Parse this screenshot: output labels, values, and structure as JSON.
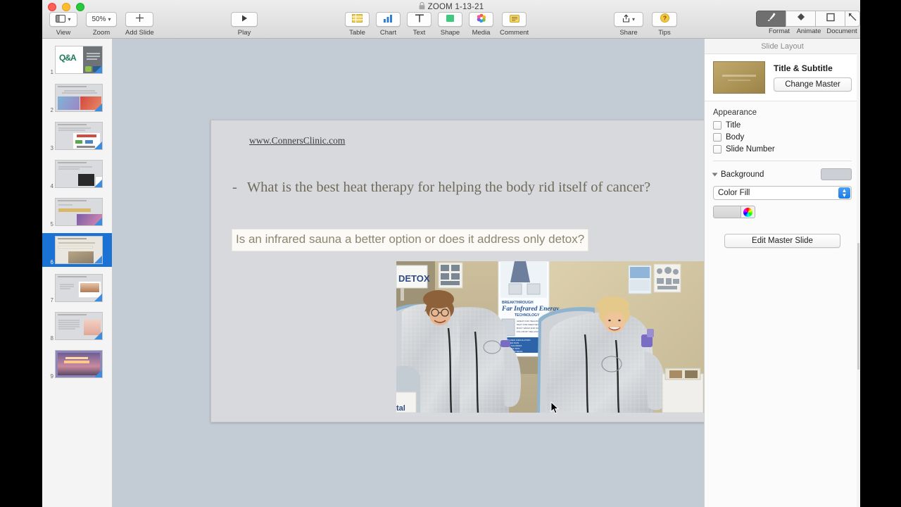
{
  "window": {
    "document_title": "ZOOM 1-13-21",
    "title_icon": "lock-icon"
  },
  "toolbar": {
    "left_items": [
      {
        "name": "view",
        "label": "View",
        "icon": "view-panels-icon",
        "has_chevron": true
      },
      {
        "name": "zoom",
        "label": "Zoom",
        "icon": "zoom-percent",
        "value": "50%",
        "has_chevron": true
      },
      {
        "name": "add-slide",
        "label": "Add Slide",
        "icon": "plus-icon"
      }
    ],
    "play": {
      "label": "Play",
      "icon": "play-triangle-icon"
    },
    "insert_items": [
      {
        "name": "table",
        "label": "Table",
        "icon": "table-icon"
      },
      {
        "name": "chart",
        "label": "Chart",
        "icon": "bar-chart-icon"
      },
      {
        "name": "text",
        "label": "Text",
        "icon": "text-t-icon"
      },
      {
        "name": "shape",
        "label": "Shape",
        "icon": "shape-square-icon"
      },
      {
        "name": "media",
        "label": "Media",
        "icon": "media-photos-icon"
      },
      {
        "name": "comment",
        "label": "Comment",
        "icon": "comment-lines-icon"
      }
    ],
    "right_items": [
      {
        "name": "share",
        "label": "Share",
        "icon": "share-arrow-icon",
        "has_chevron": true
      },
      {
        "name": "tips",
        "label": "Tips",
        "icon": "question-mark-icon"
      }
    ],
    "inspector_tabs": [
      {
        "name": "format",
        "label": "Format",
        "icon": "paintbrush-icon",
        "selected": true
      },
      {
        "name": "animate",
        "label": "Animate",
        "icon": "diamond-icon",
        "selected": false
      },
      {
        "name": "document",
        "label": "Document",
        "icon": "document-square-icon",
        "selected": false
      },
      {
        "name": "setup",
        "label": "",
        "icon": "ruler-icon",
        "selected": false
      }
    ]
  },
  "navigator": {
    "slides": [
      {
        "number": "1",
        "kind": "qa-title"
      },
      {
        "number": "2",
        "kind": "two-photos"
      },
      {
        "number": "3",
        "kind": "diagram"
      },
      {
        "number": "4",
        "kind": "device-photo"
      },
      {
        "number": "5",
        "kind": "sunset-photo"
      },
      {
        "number": "6",
        "kind": "sauna-photo",
        "selected": true
      },
      {
        "number": "7",
        "kind": "skin-diagram"
      },
      {
        "number": "8",
        "kind": "text-photo"
      },
      {
        "number": "9",
        "kind": "road-sunset"
      }
    ]
  },
  "slide": {
    "url": "www.ConnersClinic.com",
    "bullet_marker": "-",
    "question": "What is the best heat therapy for helping the body rid itself of cancer?",
    "highlighted": "Is an infrared sauna a better option or does it address only detox?",
    "photo": {
      "name": "infrared-sauna-photo",
      "sign_text": "DETOX",
      "banner_line1": "BREAKTHROUGH",
      "banner_line2": "Far Infrared Energy",
      "banner_line3": "TECHNOLOGY",
      "corner_text": "tal"
    }
  },
  "inspector": {
    "title": "Slide Layout",
    "master": {
      "name": "Title & Subtitle",
      "change_master_label": "Change Master"
    },
    "appearance": {
      "label": "Appearance",
      "options": [
        {
          "label": "Title",
          "checked": false
        },
        {
          "label": "Body",
          "checked": false
        },
        {
          "label": "Slide Number",
          "checked": false
        }
      ]
    },
    "background": {
      "label": "Background",
      "fill_type": "Color Fill"
    },
    "edit_master_label": "Edit Master Slide"
  },
  "colors": {
    "accent_blue": "#1a72d4",
    "slide_bg": "#d7d9dd",
    "canvas_bg": "#c3cbd4",
    "slide_text": "#6f6a5a",
    "highlight_text": "#8d856f"
  }
}
